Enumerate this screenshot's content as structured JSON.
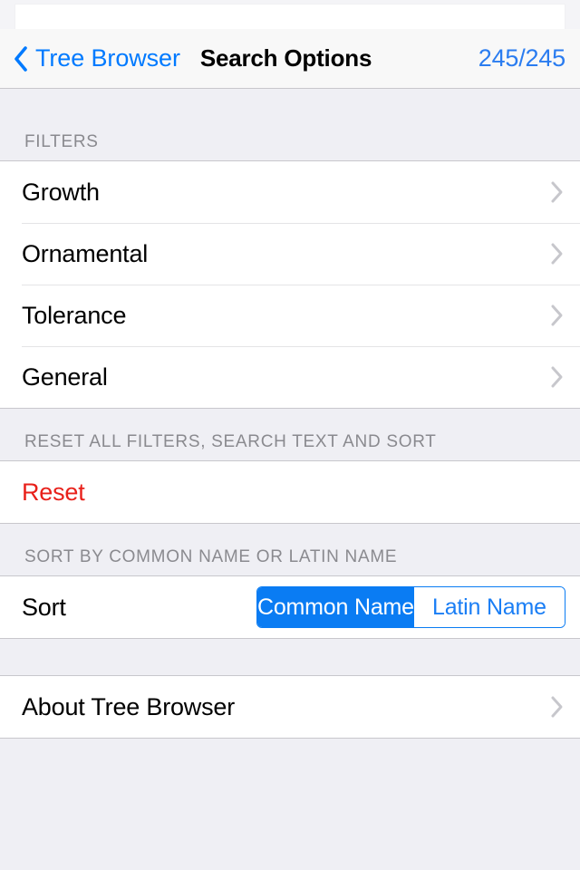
{
  "navbar": {
    "back_label": "Tree Browser",
    "back_icon": "chevron-left-icon",
    "title": "Search Options",
    "count_badge": "245/245"
  },
  "colors": {
    "accent_blue": "#007aff",
    "segment_blue": "#0a7cf3",
    "destructive_red": "#e8201a",
    "table_background": "#efeff4",
    "row_background": "#ffffff",
    "separator": "#c8c7cc",
    "header_text": "#8a8a8f",
    "chevron_gray": "#c7c7cc"
  },
  "sections": [
    {
      "header": "FILTERS",
      "rows": [
        {
          "label": "Growth",
          "accessory": "chevron-right-icon"
        },
        {
          "label": "Ornamental",
          "accessory": "chevron-right-icon"
        },
        {
          "label": "Tolerance",
          "accessory": "chevron-right-icon"
        },
        {
          "label": "General",
          "accessory": "chevron-right-icon"
        }
      ]
    },
    {
      "header": "RESET ALL FILTERS, SEARCH TEXT AND SORT",
      "rows": [
        {
          "label": "Reset",
          "style": "destructive"
        }
      ]
    },
    {
      "header": "SORT BY COMMON NAME OR LATIN NAME",
      "rows": [
        {
          "label": "Sort",
          "control": "segmented",
          "options": [
            "Common Name",
            "Latin Name"
          ],
          "selected": "Common Name",
          "selected_index": 0
        }
      ]
    },
    {
      "header": "",
      "rows": [
        {
          "label": "About Tree Browser",
          "accessory": "chevron-right-icon"
        }
      ]
    }
  ]
}
